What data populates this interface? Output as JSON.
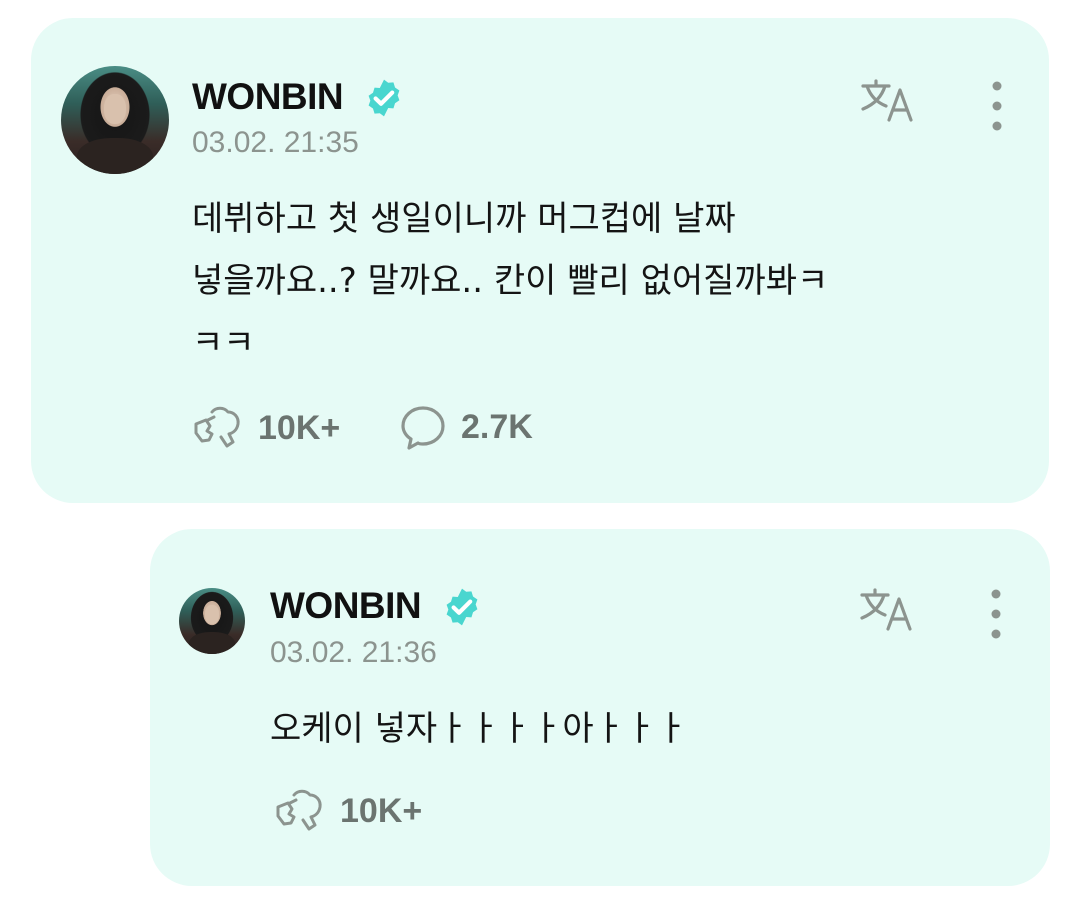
{
  "posts": [
    {
      "author": "WONBIN",
      "timestamp": "03.02. 21:35",
      "text": "데뷔하고 첫 생일이니까 머그컵에 날짜\n넣을까요..? 말까요.. 칸이 빨리 없어질까봐ㅋ\nㅋㅋ",
      "likes": "10K+",
      "comments": "2.7K"
    },
    {
      "author": "WONBIN",
      "timestamp": "03.02. 21:36",
      "text": "오케이 넣자ㅏㅏㅏㅏ아ㅏㅏㅏ",
      "likes": "10K+"
    }
  ],
  "icons": {
    "verified": "verified-badge-icon",
    "translate": "translate-icon",
    "more": "more-vertical-icon",
    "like": "heart-hand-icon",
    "comment": "speech-bubble-icon"
  },
  "colors": {
    "card_background": "#e6fbf6",
    "verified_badge": "#49d6cf",
    "icon_gray": "#8c948f"
  }
}
